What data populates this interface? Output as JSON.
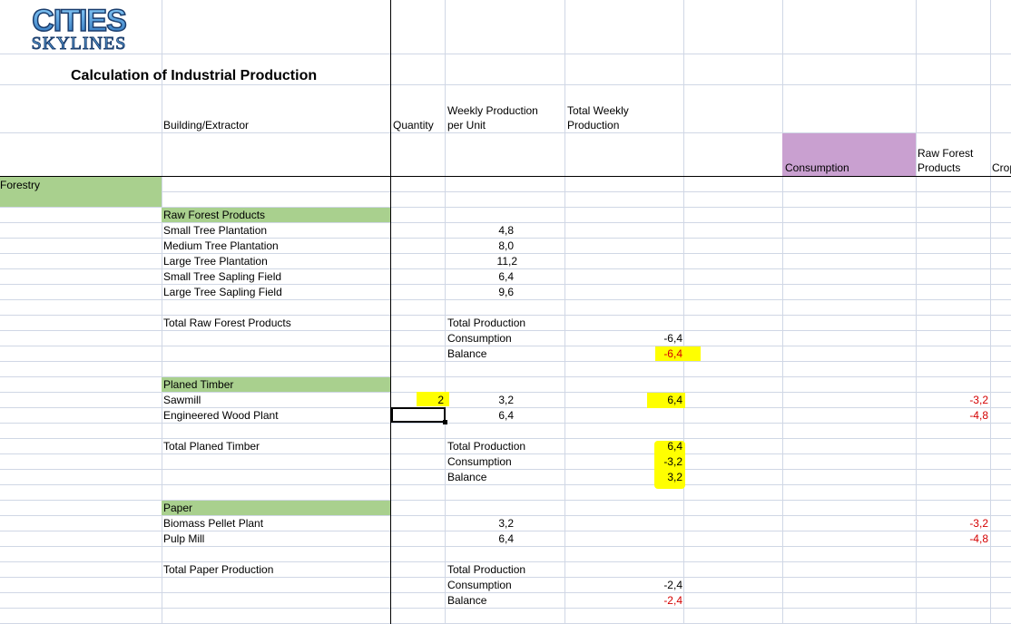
{
  "logo": {
    "line1": "CITIES",
    "line2": "SKYLINES"
  },
  "sheet": {
    "title": "Calculation of Industrial Production",
    "headers": {
      "building": "Building/Extractor",
      "quantity": "Quantity",
      "weekly_line1": "Weekly Production",
      "weekly_line2": "per Unit",
      "total_line1": "Total Weekly",
      "total_line2": "Production",
      "consumption": "Consumption",
      "raw_line1": "Raw Forest",
      "raw_line2": "Products",
      "crops_partial": "Crop"
    },
    "category": "Forestry",
    "raw": {
      "heading": "Raw Forest Products",
      "rows": [
        {
          "name": "Small Tree Plantation",
          "weekly": "4,8"
        },
        {
          "name": "Medium Tree Plantation",
          "weekly": "8,0"
        },
        {
          "name": "Large Tree Plantation",
          "weekly": "11,2"
        },
        {
          "name": "Small Tree Sapling Field",
          "weekly": "6,4"
        },
        {
          "name": "Large Tree Sapling Field",
          "weekly": "9,6"
        }
      ],
      "total_label": "Total Raw Forest Products",
      "total_production": "Total Production",
      "consumption": "Consumption",
      "balance": "Balance",
      "consumption_value": "-6,4",
      "balance_value": "-6,4"
    },
    "planed": {
      "heading": "Planed Timber",
      "rows": [
        {
          "name": "Sawmill",
          "qty": "2",
          "weekly": "3,2",
          "total": "6,4",
          "raw": "-3,2"
        },
        {
          "name": "Engineered Wood Plant",
          "qty": "",
          "weekly": "6,4",
          "total": "",
          "raw": "-4,8"
        }
      ],
      "total_label": "Total Planed Timber",
      "total_production": "Total Production",
      "consumption": "Consumption",
      "balance": "Balance",
      "production_value": "6,4",
      "consumption_value": "-3,2",
      "balance_value": "3,2"
    },
    "paper": {
      "heading": "Paper",
      "rows": [
        {
          "name": "Biomass Pellet Plant",
          "weekly": "3,2",
          "raw": "-3,2"
        },
        {
          "name": "Pulp Mill",
          "weekly": "6,4",
          "raw": "-4,8"
        }
      ],
      "total_label": "Total Paper Production",
      "total_production": "Total Production",
      "consumption": "Consumption",
      "balance": "Balance",
      "consumption_value": "-2,4",
      "balance_value": "-2,4"
    }
  },
  "colors": {
    "green": "#a9d08e",
    "purple": "#c9a0d0",
    "highlight": "#ffff00",
    "negative": "#d40000",
    "grid": "#d0d7e5"
  }
}
